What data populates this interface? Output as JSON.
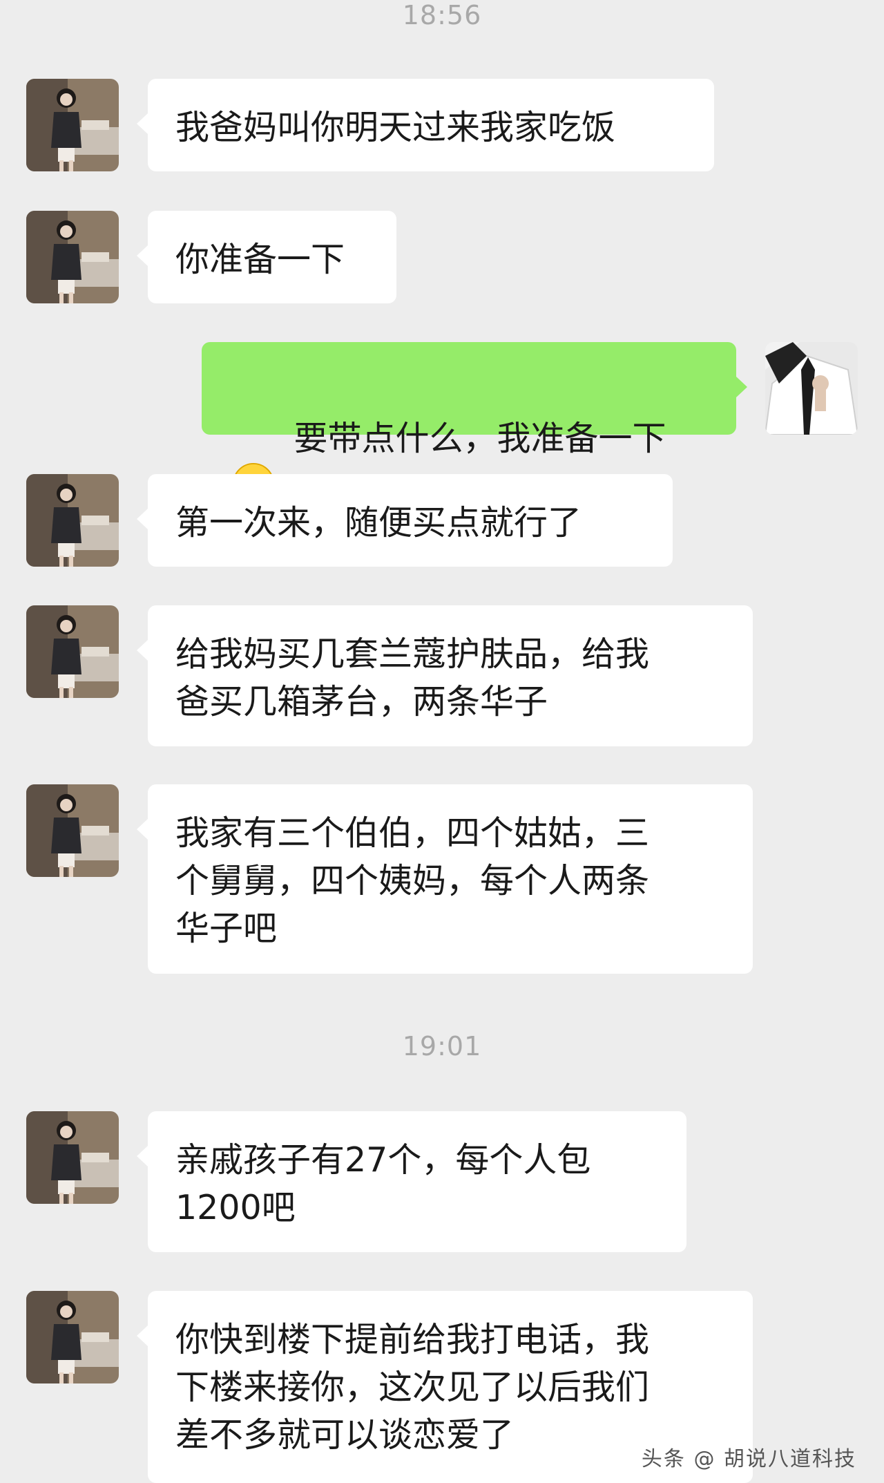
{
  "timestamps": [
    "18:56",
    "19:01"
  ],
  "messages": [
    {
      "side": "left",
      "text": "我爸妈叫你明天过来我家吃饭"
    },
    {
      "side": "left",
      "text": "你准备一下"
    },
    {
      "side": "right",
      "text": "要带点什么，我准备一下",
      "emoji": "grinning-face-icon"
    },
    {
      "side": "left",
      "text": "第一次来，随便买点就行了"
    },
    {
      "side": "left",
      "text": "给我妈买几套兰蔻护肤品，给我\n爸买几箱茅台，两条华子"
    },
    {
      "side": "left",
      "text": "我家有三个伯伯，四个姑姑，三\n个舅舅，四个姨妈，每个人两条\n华子吧"
    },
    {
      "side": "left",
      "text": "亲戚孩子有27个，每个人包\n1200吧"
    },
    {
      "side": "left",
      "text": "你快到楼下提前给我打电话，我\n下楼来接你，这次见了以后我们\n差不多就可以谈恋爱了"
    }
  ],
  "watermark": "头条 @ 胡说八道科技",
  "colors": {
    "background": "#ededed",
    "bubble_incoming": "#ffffff",
    "bubble_outgoing": "#95ec69",
    "timestamp": "#a8a8a8"
  }
}
